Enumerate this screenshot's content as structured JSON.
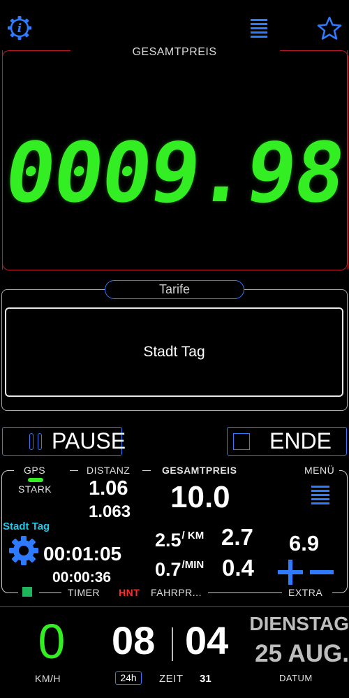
{
  "header": {
    "info_icon": "info-gear-icon",
    "menu_icon": "hamburger-icon",
    "favorite_icon": "star-icon"
  },
  "price": {
    "title": "GESAMTPREIS",
    "display": "0009.98"
  },
  "tariff": {
    "title": "Tarife",
    "selected": "Stadt Tag"
  },
  "controls": {
    "pause_label": "PAUSE",
    "end_label": "ENDE"
  },
  "panel": {
    "gps_label": "GPS",
    "gps_strength": "STARK",
    "distance_label": "DISTANZ",
    "distance_main": "1.06",
    "distance_sub": "1.063",
    "total_label": "GESAMTPREIS",
    "total_value": "10.0",
    "menu_label": "MENÜ",
    "tariff_name": "Stadt Tag",
    "time_main": "00:01:05",
    "time_sub": "00:00:36",
    "rate_km": "2.5",
    "rate_km_unit": "/ KM",
    "rate_km_total": "2.7",
    "rate_min": "0.7",
    "rate_min_unit": "/MIN",
    "rate_min_total": "0.4",
    "extra_value": "6.9",
    "timer_label": "TIMER",
    "hnt_label": "HNT",
    "fahrpreis_label": "FAHRPR...",
    "extra_label": "EXTRA"
  },
  "footer": {
    "speed": "0",
    "speed_unit": "KM/H",
    "hours": "08",
    "minutes": "04",
    "seconds": "31",
    "mode_24h": "24h",
    "time_label": "ZEIT",
    "weekday": "DIENSTAG",
    "date": "25 AUG.",
    "date_label": "DATUM"
  },
  "colors": {
    "accent_blue": "#2f7bff",
    "lcd_green": "#33ee22",
    "frame_red": "#c0182a",
    "tariff_cyan": "#22c7e8",
    "hnt_red": "#ff2a2a"
  }
}
